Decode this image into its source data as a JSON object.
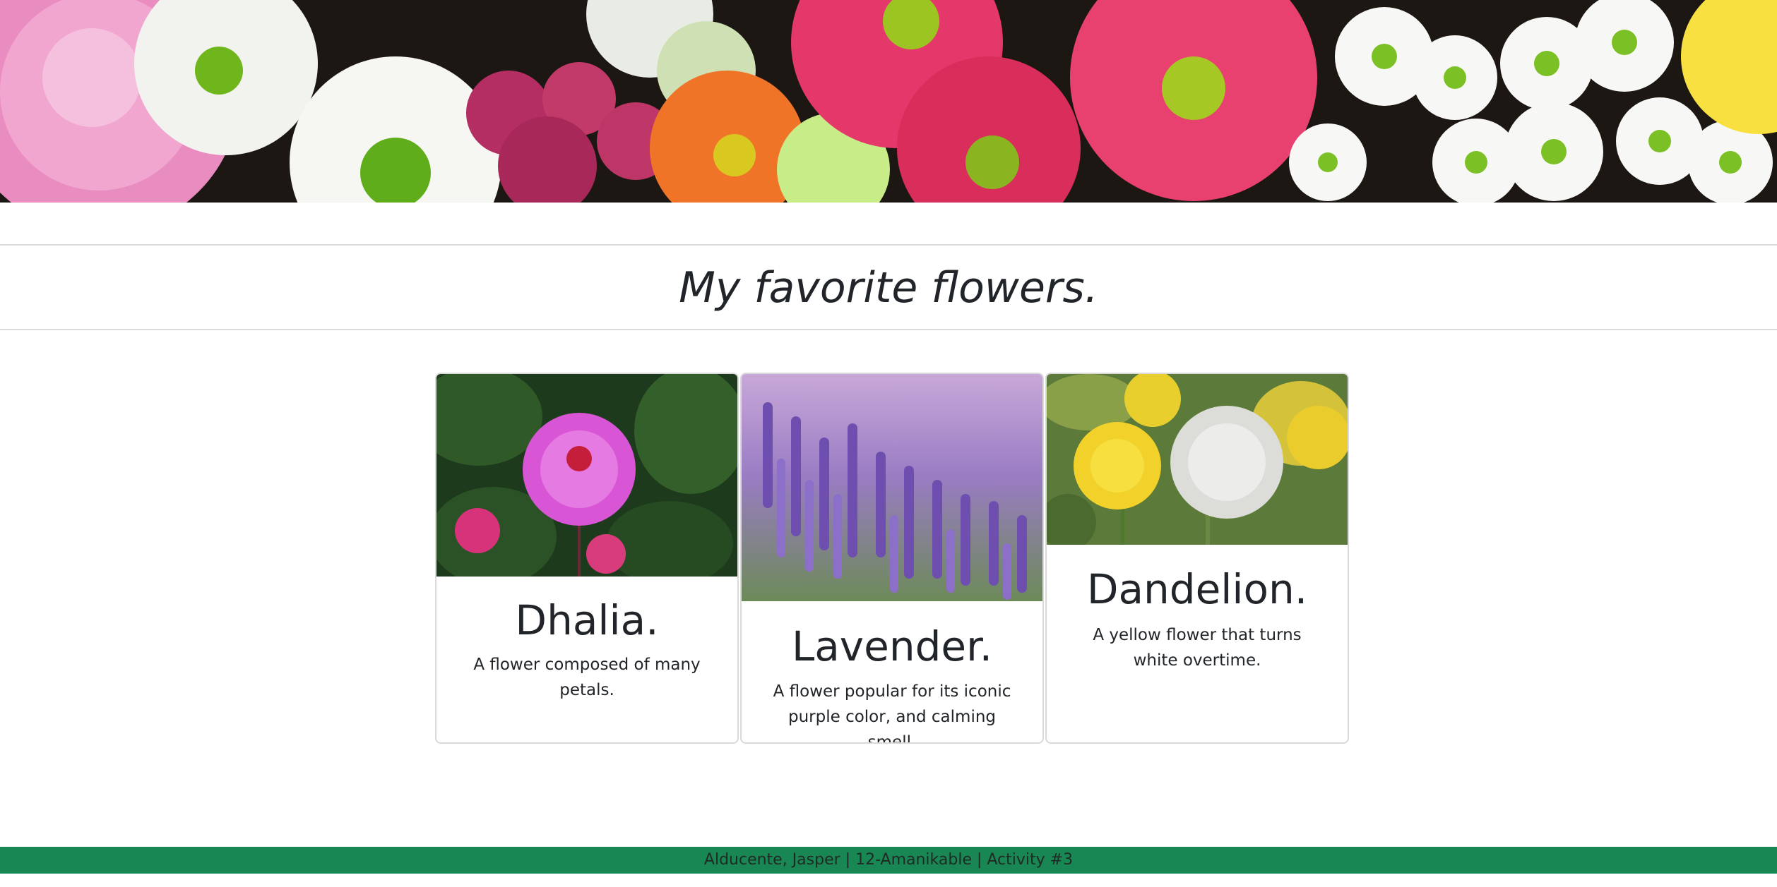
{
  "banner": {
    "image": "mixed chrysanthemum and gerbera flower bouquet banner",
    "colors": {
      "pink": "#e77fb6",
      "magenta": "#c13a6a",
      "red": "#e0325b",
      "orange": "#f0752a",
      "white": "#f4f4f2",
      "green_center": "#6fb61d",
      "yellow": "#f8e040",
      "dark": "#1a1410"
    }
  },
  "header": {
    "title": "My favorite flowers."
  },
  "cards": [
    {
      "image": "pink dahlia flower photo",
      "title": "Dhalia.",
      "text": "A flower composed of many petals."
    },
    {
      "image": "lavender field photo",
      "title": "Lavender.",
      "text": "A flower popular for its iconic purple color, and calming smell."
    },
    {
      "image": "dandelion flowers photo",
      "title": "Dandelion.",
      "text": "A yellow flower that turns white overtime."
    }
  ],
  "footer": {
    "text": "Alducente, Jasper | 12-Amanikable | Activity #3",
    "background": "#198754"
  }
}
